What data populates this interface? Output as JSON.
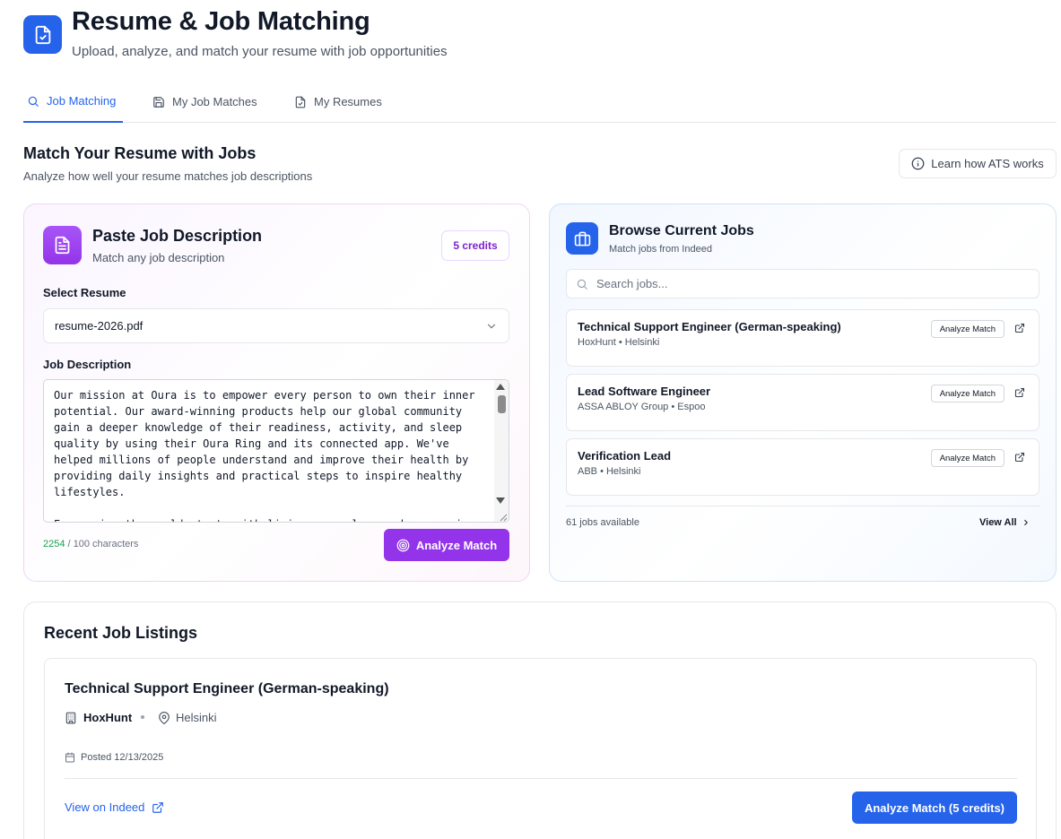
{
  "header": {
    "title": "Resume & Job Matching",
    "subtitle": "Upload, analyze, and match your resume with job opportunities"
  },
  "tabs": [
    {
      "label": "Job Matching",
      "icon": "search-icon",
      "active": true
    },
    {
      "label": "My Job Matches",
      "icon": "save-icon",
      "active": false
    },
    {
      "label": "My Resumes",
      "icon": "file-check-icon",
      "active": false
    }
  ],
  "section": {
    "title": "Match Your Resume with Jobs",
    "subtitle": "Analyze how well your resume matches job descriptions",
    "ats_button": "Learn how ATS works"
  },
  "paste_card": {
    "title": "Paste Job Description",
    "subtitle": "Match any job description",
    "credits": "5 credits",
    "select_label": "Select Resume",
    "selected_resume": "resume-2026.pdf",
    "description_label": "Job Description",
    "description_text": "Our mission at Oura is to empower every person to own their inner potential. Our award-winning products help our global community gain a deeper knowledge of their readiness, activity, and sleep quality by using their Oura Ring and its connected app. We've helped millions of people understand and improve their health by providing daily insights and practical steps to inspire healthy lifestyles.\n\nEmpowering the world starts with living our values and empowering our team. As a rapidly growing company focused on helping people live",
    "char_count": "2254",
    "char_suffix": " / 100 characters",
    "analyze_button": "Analyze Match",
    "accent": "#9333ea"
  },
  "browse_card": {
    "title": "Browse Current Jobs",
    "subtitle": "Match jobs from Indeed",
    "search_placeholder": "Search jobs...",
    "jobs": [
      {
        "title": "Technical Support Engineer (German-speaking)",
        "meta": "HoxHunt • Helsinki",
        "action": "Analyze Match"
      },
      {
        "title": "Lead Software Engineer",
        "meta": "ASSA ABLOY Group • Espoo",
        "action": "Analyze Match"
      },
      {
        "title": "Verification Lead",
        "meta": "ABB • Helsinki",
        "action": "Analyze Match"
      }
    ],
    "jobs_available": "61 jobs available",
    "view_all": "View All",
    "accent": "#2563eb"
  },
  "recent": {
    "title": "Recent Job Listings",
    "listing": {
      "title": "Technical Support Engineer (German-speaking)",
      "company": "HoxHunt",
      "location": "Helsinki",
      "posted": "Posted 12/13/2025",
      "view_link": "View on Indeed",
      "analyze_button": "Analyze Match (5 credits)"
    }
  }
}
